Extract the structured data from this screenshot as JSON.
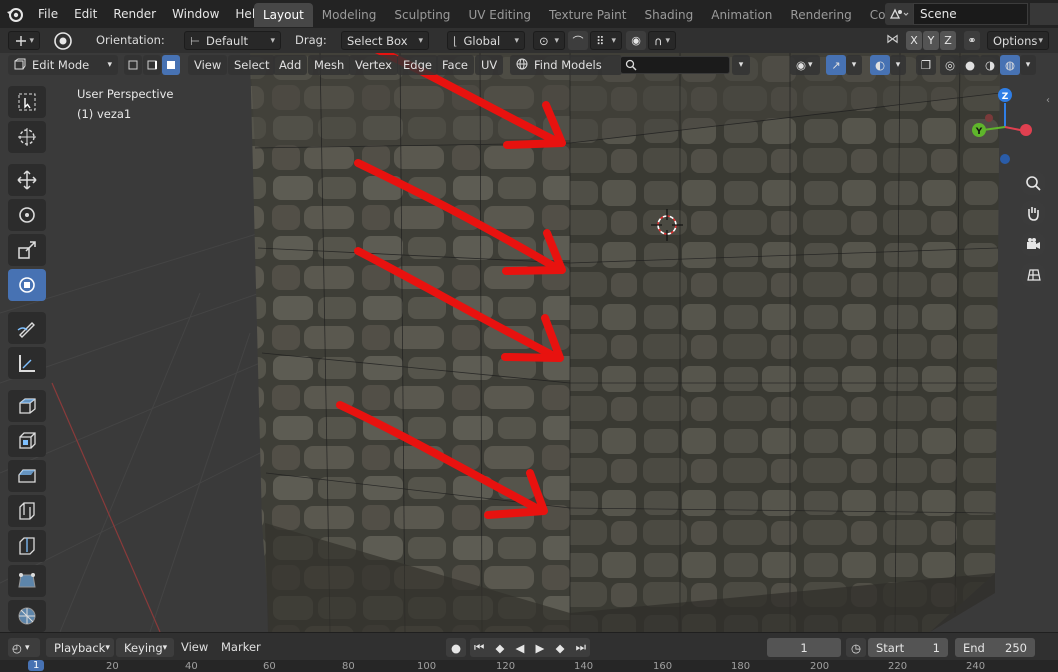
{
  "menu": {
    "items": [
      "File",
      "Edit",
      "Render",
      "Window",
      "Help"
    ]
  },
  "workspaces": [
    "Layout",
    "Modeling",
    "Sculpting",
    "UV Editing",
    "Texture Paint",
    "Shading",
    "Animation",
    "Rendering",
    "Compositing"
  ],
  "scene": {
    "name": "Scene"
  },
  "tool_settings": {
    "orientation_label": "Orientation:",
    "orientation_value": "Default",
    "drag_label": "Drag:",
    "drag_value": "Select Box",
    "transform_orientation": "Global",
    "axis_x": "X",
    "axis_y": "Y",
    "axis_z": "Z",
    "options_label": "Options"
  },
  "viewport_header": {
    "mode": "Edit Mode",
    "menus": [
      "View",
      "Select",
      "Add",
      "Mesh",
      "Vertex",
      "Edge",
      "Face",
      "UV"
    ],
    "find_models": "Find Models",
    "search_placeholder": ""
  },
  "viewport": {
    "perspective": "User Perspective",
    "object": "(1) veza1",
    "gizmo": {
      "z": "Z",
      "y": "Y",
      "x": "X"
    }
  },
  "timeline": {
    "playback": "Playback",
    "keying": "Keying",
    "view": "View",
    "marker": "Marker",
    "current_frame": "1",
    "start_label": "Start",
    "start_value": "1",
    "end_label": "End",
    "end_value": "250"
  },
  "ruler": {
    "marks": [
      "1",
      "20",
      "40",
      "60",
      "80",
      "100",
      "120",
      "140",
      "160",
      "180",
      "200",
      "220",
      "240"
    ]
  },
  "colors": {
    "accent": "#4772b3",
    "annotation_arrow": "#e8120f",
    "active_tab": "#474747"
  }
}
